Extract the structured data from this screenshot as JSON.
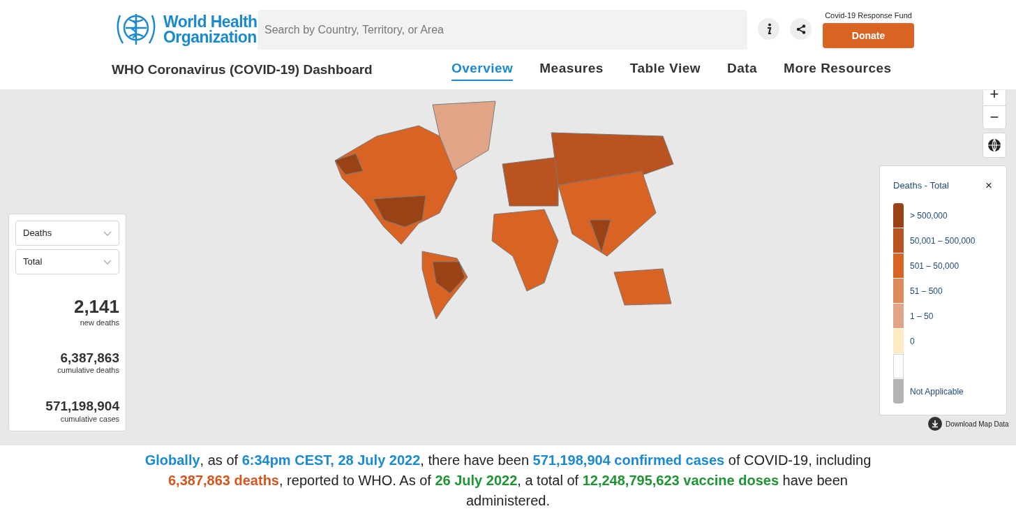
{
  "header": {
    "logo_text": [
      "World Health",
      "Organization"
    ],
    "search": {
      "placeholder": "Search by Country, Territory, or Area"
    },
    "fund_label": "Covid-19 Response Fund",
    "donate": "Donate"
  },
  "nav": {
    "title": "WHO Coronavirus (COVID-19) Dashboard",
    "tabs": [
      {
        "label": "Overview",
        "selected": true
      },
      {
        "label": "Measures",
        "selected": false
      },
      {
        "label": "Table View",
        "selected": false
      },
      {
        "label": "Data",
        "selected": false
      },
      {
        "label": "More Resources",
        "selected": false
      }
    ]
  },
  "zoom_controls": [
    "+",
    "−"
  ],
  "panel": {
    "dropdowns": [
      "Deaths",
      "Total"
    ],
    "stats": [
      {
        "value": "2,141",
        "label": "new deaths",
        "kind": "main"
      },
      {
        "value": "6,387,863",
        "label": "cumulative deaths",
        "kind": "sub"
      },
      {
        "value": "571,198,904",
        "label": "cumulative cases",
        "kind": "sub"
      }
    ]
  },
  "legend": {
    "title": "Deaths - Total",
    "close": "×",
    "items": [
      {
        "label": "> 500,000",
        "color": "#994215"
      },
      {
        "label": "50,001 – 500,000",
        "color": "#b9531f"
      },
      {
        "label": "501 – 50,000",
        "color": "#d86323"
      },
      {
        "label": "51 – 500",
        "color": "#df8a5c"
      },
      {
        "label": "1 – 50",
        "color": "#e2a486"
      },
      {
        "label": "0",
        "color": "#feebc2"
      },
      {
        "color": "#ffffff"
      },
      {
        "label": "Not Applicable",
        "color": "#b3b3b3"
      }
    ]
  },
  "download": "Download Map Data",
  "summary": [
    {
      "text": "Globally",
      "color": "#1a8ad0"
    },
    {
      "text": ", as of "
    },
    {
      "text": "6:34pm CEST, 28 July 2022",
      "color": "#1a8ad0"
    },
    {
      "text": ", there have been "
    },
    {
      "text": "571,198,904 confirmed cases",
      "color": "#1a8ad0"
    },
    {
      "text": " of COVID-19, including "
    },
    {
      "text": "6,387,863 deaths",
      "color": "#d2571e"
    },
    {
      "text": ", reported to WHO. As of "
    },
    {
      "text": "26 July 2022",
      "color": "#1e9433"
    },
    {
      "text": ", a total of "
    },
    {
      "text": "12,248,795,623 vaccine doses",
      "color": "#1e9433"
    },
    {
      "text": " have been administered."
    }
  ]
}
